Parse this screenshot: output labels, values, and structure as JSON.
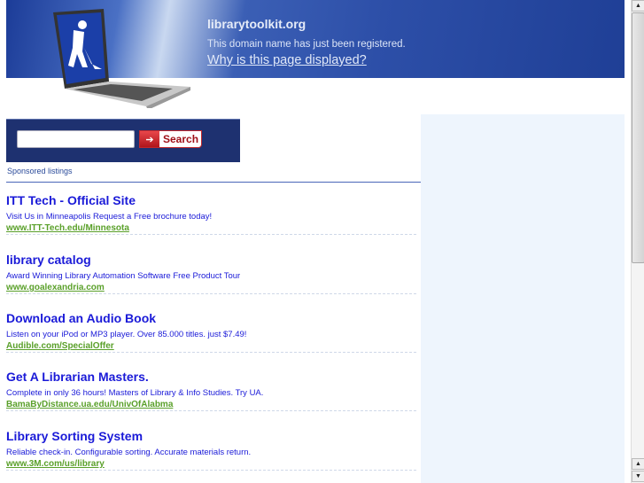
{
  "header": {
    "domain": "librarytoolkit.org",
    "notice": "This domain name has just been registered.",
    "why_link": "Why is this page displayed?"
  },
  "search": {
    "value": "",
    "button_label": "Search"
  },
  "sponsored_label": "Sponsored listings",
  "ads": [
    {
      "title": "ITT Tech - Official Site",
      "desc": "Visit Us in Minneapolis Request a Free brochure today!",
      "url": "www.ITT-Tech.edu/Minnesota"
    },
    {
      "title": "library catalog",
      "desc": "Award Winning Library Automation Software Free Product Tour",
      "url": "www.goalexandria.com"
    },
    {
      "title": "Download an Audio Book",
      "desc": "Listen on your iPod or MP3 player. Over 85.000 titles. just $7.49!",
      "url": "Audible.com/SpecialOffer"
    },
    {
      "title": "Get A Librarian Masters.",
      "desc": "Complete in only 36 hours! Masters of Library & Info Studies. Try UA.",
      "url": "BamaByDistance.ua.edu/UnivOfAlabma"
    },
    {
      "title": "Library Sorting System",
      "desc": "Reliable check-in. Configurable sorting. Accurate materials return.",
      "url": "www.3M.com/us/library"
    }
  ]
}
